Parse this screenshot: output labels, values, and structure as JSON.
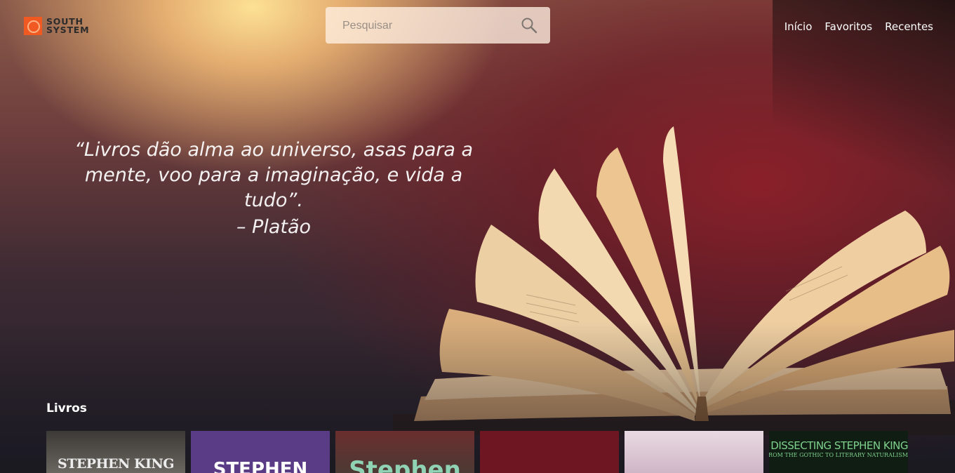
{
  "brand": {
    "logo_line1": "SOUTH",
    "logo_line2": "SYSTEM",
    "accent": "#f05a22"
  },
  "search": {
    "placeholder": "Pesquisar",
    "value": "",
    "icon": "search-icon"
  },
  "nav": {
    "items": [
      "Início",
      "Favoritos",
      "Recentes"
    ]
  },
  "hero": {
    "quote_line1": "“Livros dão alma ao universo, asas para a",
    "quote_line2": "mente, voo para a imaginação, e vida a tudo”.",
    "author": "– Platão"
  },
  "books_section": {
    "title": "Livros",
    "covers": [
      {
        "text": "STEPHEN KING",
        "color": "#4a4743"
      },
      {
        "text": "STEPHEN",
        "color": "#5a3b86"
      },
      {
        "text": "Stephen",
        "color": "#6a2e2e"
      },
      {
        "text": "",
        "color": "#6e1622"
      },
      {
        "text": "",
        "color": "#e0cdd8"
      },
      {
        "text": "DISSECTING STEPHEN KING",
        "subtext": "FROM THE GOTHIC TO LITERARY NATURALISM",
        "color": "#0f1d12"
      }
    ]
  }
}
